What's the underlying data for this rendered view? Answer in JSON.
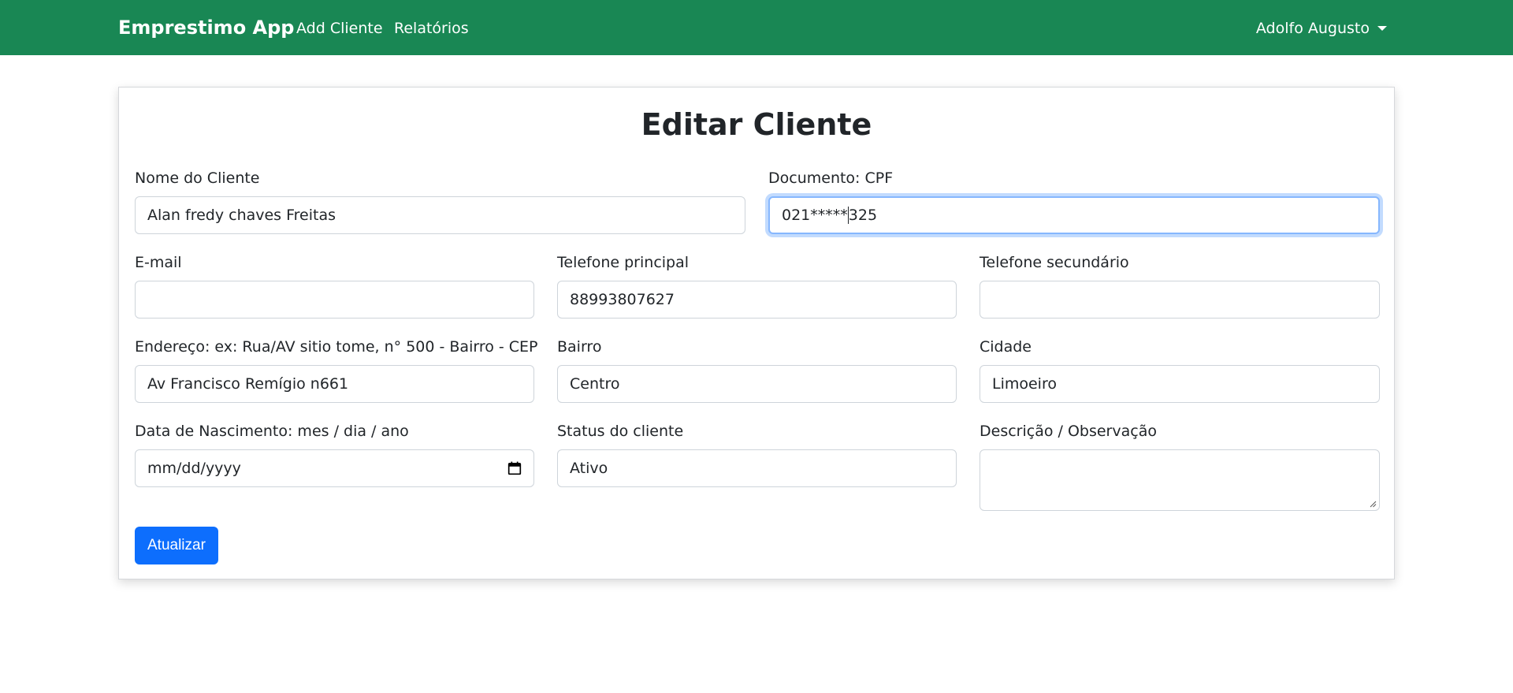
{
  "navbar": {
    "brand": "Emprestimo App",
    "links": [
      "Add Cliente",
      "Relatórios"
    ],
    "user": "Adolfo Augusto",
    "color": "#198754"
  },
  "form": {
    "title": "Editar Cliente",
    "fields": {
      "nome": {
        "label": "Nome do Cliente",
        "value": "Alan fredy chaves Freitas"
      },
      "documento": {
        "label": "Documento: CPF",
        "value_before_cursor": "021*****",
        "value_after_cursor": "325"
      },
      "email": {
        "label": "E-mail",
        "value": ""
      },
      "telefone_principal": {
        "label": "Telefone principal",
        "value": "88993807627"
      },
      "telefone_secundario": {
        "label": "Telefone secundário",
        "value": ""
      },
      "endereco": {
        "label": "Endereço: ex: Rua/AV sitio tome, n° 500 - Bairro - CEP",
        "value": "Av Francisco Remígio n661"
      },
      "bairro": {
        "label": "Bairro",
        "value": "Centro"
      },
      "cidade": {
        "label": "Cidade",
        "value": "Limoeiro"
      },
      "data_nascimento": {
        "label": "Data de Nascimento: mes / dia / ano",
        "placeholder": "mm/dd/yyyy",
        "icon": "calendar-icon"
      },
      "status": {
        "label": "Status do cliente",
        "value": "Ativo"
      },
      "descricao": {
        "label": "Descrição / Observação",
        "value": ""
      }
    },
    "submit_label": "Atualizar",
    "submit_color": "#0d6efd"
  }
}
